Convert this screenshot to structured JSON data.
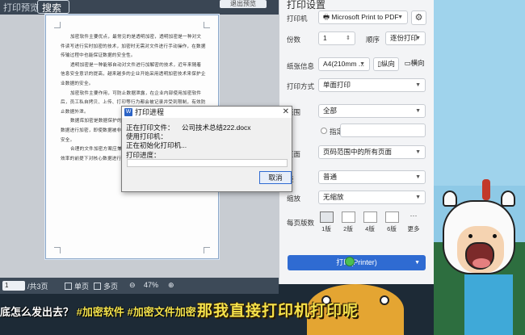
{
  "topbar": {
    "title": "打印预览",
    "search_label": "搜索",
    "exit_label": "退出预览"
  },
  "document": {
    "paragraphs": [
      "加密软件主要优点，最常见的是透明加密，透明加密是一种对文件读写进行实时加密的技术，加密时无需对文件进行手动操作，在数据传输过程中也能保证数据的安全性。",
      "透明加密是一种能够自动对文件进行加解密的技术，近年来随着信息安全意识的提高，越来越多的企业开始采用透明加密技术来保护企业数据的安全。",
      "加密软件主要作用，可防止数据泄露，在企业内部使用加密软件后，员工私自拷贝、上传、打印等行为都会被记录并受到限制，有效防止数据外泄。",
      "数据库加密是数据保护的重要手段之一，通过对数据库中的敏感数据进行加密，即使数据被非法获取也无法读取其内容，从而保障数据安全。",
      "合理的文件加密方案应兼顾安全性与易用性，在不影响正常办公效率的前提下对核心数据进行全面保护。"
    ]
  },
  "statusbar": {
    "page_current": "1",
    "page_total": "/共3页",
    "single_label": "单页",
    "multi_label": "多页",
    "zoom": "47%"
  },
  "panel": {
    "title": "打印设置",
    "printer_label": "打印机",
    "printer_value": "Microsoft Print to PDF",
    "copies_label": "份数",
    "copies_value": "1",
    "order_label": "顺序",
    "order_value": "逐份打印",
    "paper_label": "纸张信息",
    "paper_value": "A4(210mm ...",
    "portrait_label": "纵向",
    "landscape_label": "横向",
    "mode_label": "打印方式",
    "mode_value": "单面打印",
    "range_label": "范围",
    "range_value": "全部",
    "custom_pages_label": "指定页码",
    "pages_label": "页面",
    "pages_value": "页码范围中的所有页面",
    "margin_label": "距",
    "margin_value": "普通",
    "scale_label": "缩放",
    "scale_value": "无缩放",
    "pps_label": "每页版数",
    "pps_options": [
      "1版",
      "2版",
      "4版",
      "6版",
      "更多"
    ],
    "print_button": "打印(Printer)"
  },
  "dialog": {
    "title": "打印进程",
    "file_label": "正在打印文件：",
    "file_value": "公司技术总结222.docx",
    "printer_used_label": "使用打印机：",
    "init_label": "正在初始化打印机...",
    "progress_label": "打印进度：",
    "cancel_label": "取消"
  },
  "subtitle": {
    "lead": "底怎么发出去？",
    "tag1": "#加密软件",
    "tag2": "#加密文件加密",
    "big": "那我直接打印机打印呢"
  },
  "colors": {
    "accent": "#2f6bd2",
    "panel_bg": "#f3f4f6",
    "subtitle_yellow": "#f6e24a"
  }
}
